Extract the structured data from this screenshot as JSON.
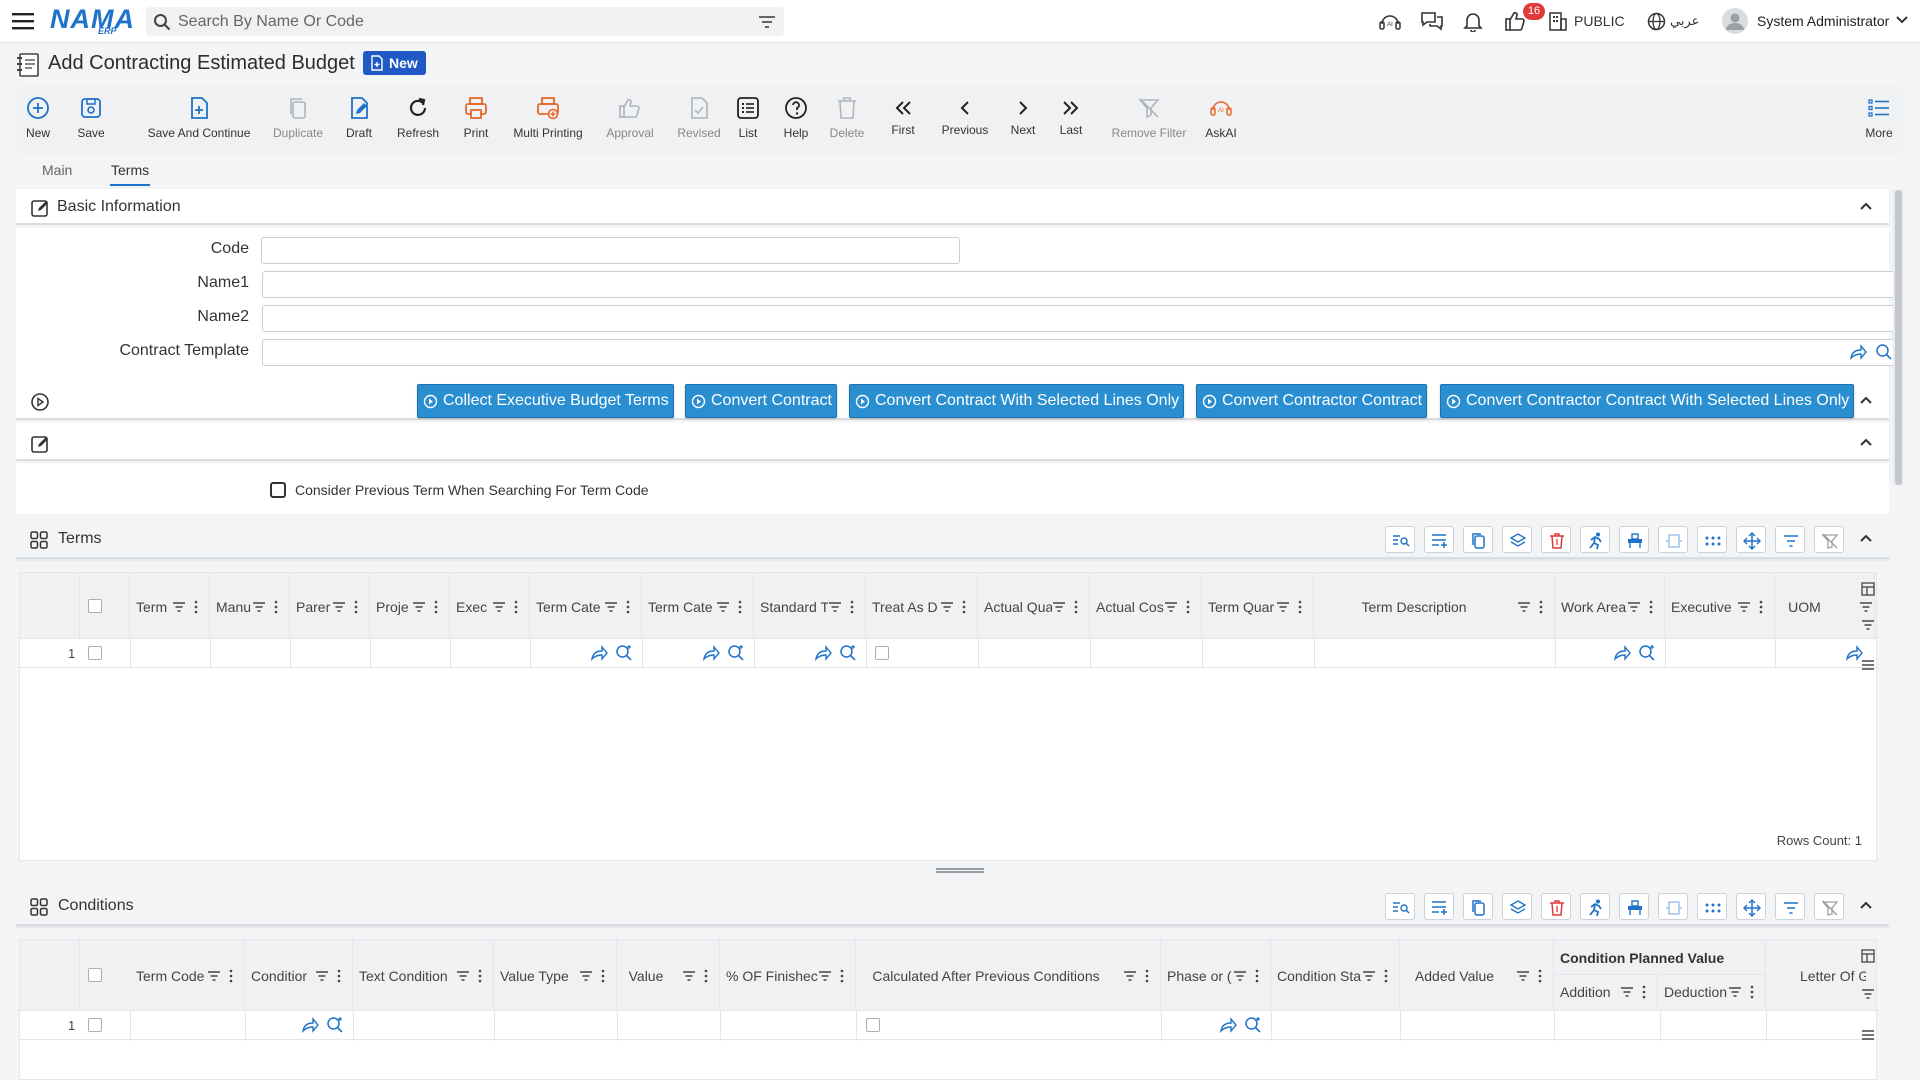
{
  "header": {
    "logo_text": "NAMA",
    "logo_sub": "ERP",
    "search_placeholder": "Search By Name Or Code",
    "notification_count": "16",
    "branch": "PUBLIC",
    "language": "عربي",
    "user_name": "System Administrator"
  },
  "page": {
    "title": "Add Contracting Estimated Budget",
    "status": "New"
  },
  "toolbar": {
    "new": "New",
    "save": "Save",
    "save_continue": "Save And Continue",
    "duplicate": "Duplicate",
    "draft": "Draft",
    "refresh": "Refresh",
    "print": "Print",
    "multi_printing": "Multi Printing",
    "approval": "Approval",
    "revised": "Revised",
    "list": "List",
    "help": "Help",
    "delete": "Delete",
    "first": "First",
    "previous": "Previous",
    "next": "Next",
    "last": "Last",
    "remove_filter": "Remove Filter",
    "askai": "AskAI",
    "more": "More"
  },
  "tabs": {
    "main": "Main",
    "terms": "Terms"
  },
  "basic_info": {
    "title": "Basic Information",
    "code_label": "Code",
    "code_value": "",
    "name1_label": "Name1",
    "name1_value": "",
    "name2_label": "Name2",
    "name2_value": "",
    "template_label": "Contract Template",
    "template_value": ""
  },
  "actions": {
    "collect": "Collect Executive Budget Terms",
    "convert": "Convert Contract",
    "convert_selected": "Convert Contract With Selected Lines Only",
    "convert_contractor": "Convert Contractor Contract",
    "convert_contractor_selected": "Convert Contractor Contract With Selected Lines Only"
  },
  "options": {
    "consider_previous": "Consider Previous Term When Searching For Term Code",
    "consider_previous_checked": false
  },
  "terms_grid": {
    "title": "Terms",
    "columns": [
      "Term",
      "Manu",
      "Parer",
      "Proje",
      "Exec",
      "Term Cate",
      "Term Cate",
      "Standard T",
      "Treat As D",
      "Actual Qua",
      "Actual Cos",
      "Term Quar",
      "Term Description",
      "Work Area",
      "Executive",
      "UOM"
    ],
    "rows": [
      {
        "num": "1"
      }
    ],
    "rows_count": "Rows Count: 1"
  },
  "conditions_grid": {
    "title": "Conditions",
    "columns": [
      "Term Code",
      "Conditior",
      "Text Condition",
      "Value Type",
      "Value",
      "% OF Finishec",
      "Calculated After Previous Conditions",
      "Phase or (",
      "Condition Sta",
      "Added Value"
    ],
    "group_header": "Condition Planned Value",
    "group_columns": [
      "Addition",
      "Deduction"
    ],
    "last_column": "Letter Of Guara",
    "rows": [
      {
        "num": "1"
      }
    ]
  },
  "colors": {
    "accent": "#1f73c8",
    "action_button": "#2a8fd0",
    "status_pill": "#2058c6",
    "print_orange": "#e8672a",
    "danger": "#e03a3a"
  }
}
